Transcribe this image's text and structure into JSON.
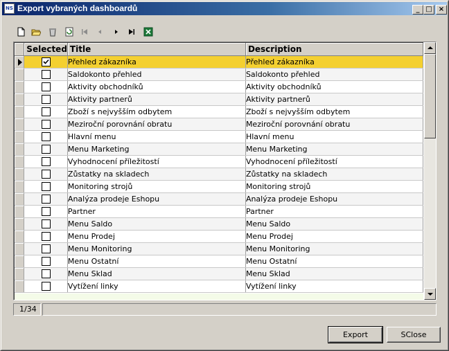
{
  "window": {
    "title": "Export vybraných dashboardů",
    "icon_text": "NS",
    "controls": {
      "minimize": "_",
      "maximize": "□",
      "close": "×"
    }
  },
  "toolbar": {
    "tools": [
      {
        "name": "new-icon",
        "enabled": true
      },
      {
        "name": "open-folder-icon",
        "enabled": true
      },
      {
        "name": "delete-icon",
        "enabled": true
      },
      {
        "name": "refresh-icon",
        "enabled": true
      },
      {
        "name": "first-record-icon",
        "enabled": false
      },
      {
        "name": "previous-record-icon",
        "enabled": false
      },
      {
        "name": "next-record-icon",
        "enabled": true
      },
      {
        "name": "last-record-icon",
        "enabled": true
      },
      {
        "name": "excel-export-icon",
        "enabled": true
      }
    ]
  },
  "grid": {
    "columns": {
      "selected": "Selected",
      "title": "Title",
      "description": "Description"
    },
    "rows": [
      {
        "selected": true,
        "title": "Přehled zákazníka",
        "description": "Přehled zákazníka"
      },
      {
        "selected": false,
        "title": "Saldokonto přehled",
        "description": "Saldokonto přehled"
      },
      {
        "selected": false,
        "title": "Aktivity obchodníků",
        "description": "Aktivity obchodníků"
      },
      {
        "selected": false,
        "title": "Aktivity partnerů",
        "description": "Aktivity partnerů"
      },
      {
        "selected": false,
        "title": "Zboží s nejvyšším odbytem",
        "description": "Zboží s nejvyšším odbytem"
      },
      {
        "selected": false,
        "title": "Meziroční porovnání obratu",
        "description": "Meziroční porovnání obratu"
      },
      {
        "selected": false,
        "title": "Hlavní menu",
        "description": "Hlavní menu"
      },
      {
        "selected": false,
        "title": "Menu Marketing",
        "description": "Menu Marketing"
      },
      {
        "selected": false,
        "title": "Vyhodnocení příležitostí",
        "description": "Vyhodnocení příležitostí"
      },
      {
        "selected": false,
        "title": "Zůstatky na skladech",
        "description": "Zůstatky na skladech"
      },
      {
        "selected": false,
        "title": "Monitoring strojů",
        "description": "Monitoring strojů"
      },
      {
        "selected": false,
        "title": "Analýza prodeje Eshopu",
        "description": "Analýza prodeje Eshopu"
      },
      {
        "selected": false,
        "title": "Partner",
        "description": "Partner"
      },
      {
        "selected": false,
        "title": "Menu Saldo",
        "description": "Menu Saldo"
      },
      {
        "selected": false,
        "title": "Menu Prodej",
        "description": "Menu Prodej"
      },
      {
        "selected": false,
        "title": "Menu Monitoring",
        "description": "Menu Monitoring"
      },
      {
        "selected": false,
        "title": "Menu Ostatní",
        "description": "Menu Ostatní"
      },
      {
        "selected": false,
        "title": "Menu Sklad",
        "description": "Menu Sklad"
      },
      {
        "selected": false,
        "title": "Vytížení linky",
        "description": "Vytížení linky"
      }
    ],
    "current_row_color": "#f4d030"
  },
  "status": {
    "position": "1/34",
    "rest": ""
  },
  "buttons": {
    "export": "Export",
    "close": "SClose"
  }
}
